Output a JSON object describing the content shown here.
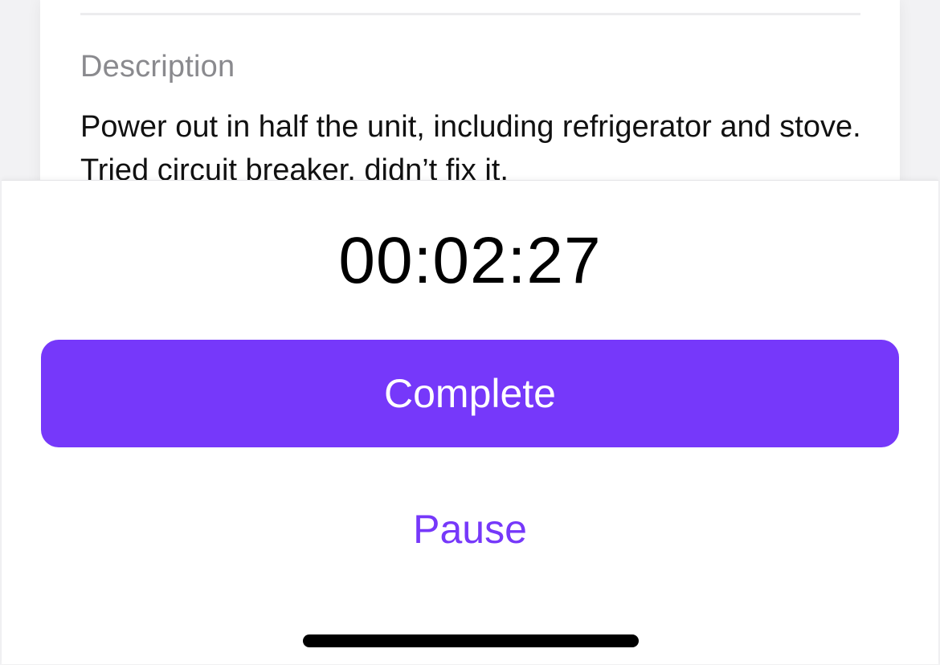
{
  "task": {
    "description_label": "Description",
    "description_text": "Power out in half the unit, including refrigerator and stove. Tried circuit breaker, didn’t fix it."
  },
  "timer": {
    "elapsed": "00:02:27"
  },
  "actions": {
    "complete_label": "Complete",
    "pause_label": "Pause"
  },
  "colors": {
    "accent": "#7638fa",
    "muted_text": "#8a8a8e",
    "background": "#f2f2f4"
  }
}
